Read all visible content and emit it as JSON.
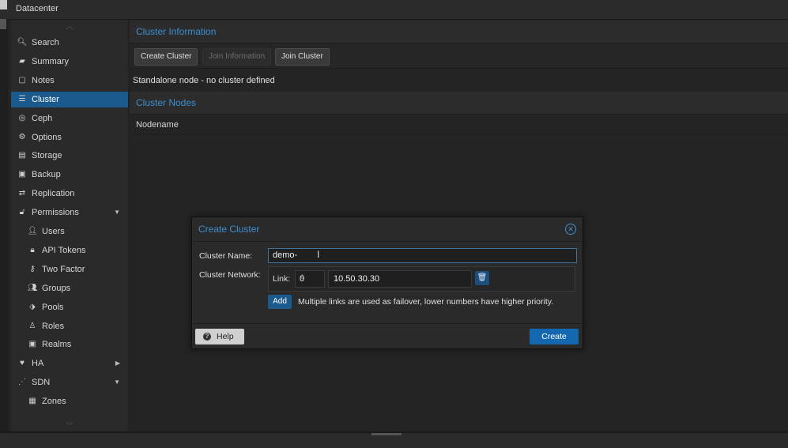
{
  "window": {
    "title": "Datacenter"
  },
  "sidebar": {
    "items": [
      {
        "label": "Search",
        "icon": "search-icon",
        "glyph": "🔍︎"
      },
      {
        "label": "Summary",
        "icon": "book-icon",
        "glyph": "▰"
      },
      {
        "label": "Notes",
        "icon": "notes-icon",
        "glyph": "▢"
      },
      {
        "label": "Cluster",
        "icon": "server-icon",
        "glyph": "☰",
        "active": true
      },
      {
        "label": "Ceph",
        "icon": "ceph-icon",
        "glyph": "◎"
      },
      {
        "label": "Options",
        "icon": "gear-icon",
        "glyph": "⚙"
      },
      {
        "label": "Storage",
        "icon": "database-icon",
        "glyph": "▤"
      },
      {
        "label": "Backup",
        "icon": "floppy-icon",
        "glyph": "▣"
      },
      {
        "label": "Replication",
        "icon": "retweet-icon",
        "glyph": "⇄"
      },
      {
        "label": "Permissions",
        "icon": "unlock-icon",
        "glyph": "🔓︎",
        "expandable": "down"
      },
      {
        "label": "Users",
        "icon": "user-icon",
        "glyph": "👤︎",
        "sub": true
      },
      {
        "label": "API Tokens",
        "icon": "lock-icon",
        "glyph": "🔒︎",
        "sub": true
      },
      {
        "label": "Two Factor",
        "icon": "key-icon",
        "glyph": "⚷",
        "sub": true
      },
      {
        "label": "Groups",
        "icon": "users-icon",
        "glyph": "👥︎",
        "sub": true
      },
      {
        "label": "Pools",
        "icon": "tags-icon",
        "glyph": "⬗",
        "sub": true
      },
      {
        "label": "Roles",
        "icon": "male-icon",
        "glyph": "♙",
        "sub": true
      },
      {
        "label": "Realms",
        "icon": "address-book-icon",
        "glyph": "▣",
        "sub": true
      },
      {
        "label": "HA",
        "icon": "heartbeat-icon",
        "glyph": "♥",
        "expandable": "right"
      },
      {
        "label": "SDN",
        "icon": "sdn-icon",
        "glyph": "⋰",
        "expandable": "down"
      },
      {
        "label": "Zones",
        "icon": "th-icon",
        "glyph": "▦",
        "sub": true
      }
    ]
  },
  "main": {
    "cluster_info_title": "Cluster Information",
    "toolbar": {
      "create_label": "Create Cluster",
      "join_info_label": "Join Information",
      "join_label": "Join Cluster"
    },
    "status_text": "Standalone node - no cluster defined",
    "nodes_title": "Cluster Nodes",
    "nodes_column": "Nodename"
  },
  "dialog": {
    "title": "Create Cluster",
    "close_glyph": "✕",
    "name_label": "Cluster Name:",
    "name_value": "demo-",
    "network_label": "Cluster Network:",
    "link_label": "Link:",
    "link_number": "0",
    "link_address": "10.50.30.30",
    "add_label": "Add",
    "hint": "Multiple links are used as failover, lower numbers have higher priority.",
    "help_label": "Help",
    "create_label": "Create"
  },
  "colors": {
    "accent": "#3d8fd1",
    "selected": "#1a5a8c",
    "primary_button": "#1468b0"
  }
}
